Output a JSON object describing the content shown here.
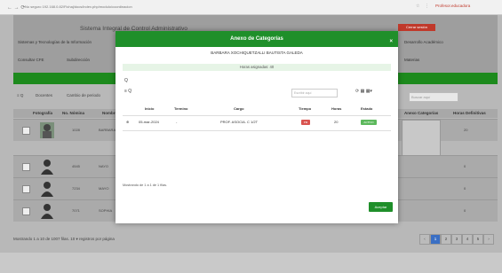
{
  "browser": {
    "nav": "←  →  ⟳",
    "url": "No seguro   192.168.0.82/Fichaj/docs/index.php/modulo/coordinacion",
    "ext1": "☆",
    "ext2": "⋮",
    "user": "Profesor.educadora"
  },
  "app": {
    "title": "Sistema Integral de Control Administrativo",
    "top_button": "Cerrar sesión",
    "menu1": "Sistemas y Tecnologías de la Información",
    "menu2": "Desarrollo Académico",
    "menu3": "Consultar CFE",
    "menu4": "Subdirección",
    "menu5": "Materias",
    "toolbar": {
      "nav": "≡  Q",
      "docentes": "Docentes",
      "cambio": "Cambio de periodo",
      "search_placeholder": "Buscar aquí"
    },
    "table_headers": {
      "fotografia": "Fotografía",
      "numero": "No. Nómina",
      "nombre": "Nombre",
      "anexo": "Anexo Categorías",
      "horas": "Horas Definitivas"
    },
    "rows": [
      {
        "id": "1028",
        "n": "BARBARA",
        "h": "20"
      },
      {
        "id": "4545",
        "n": "NAYO",
        "h": "0"
      },
      {
        "id": "7234",
        "n": "MAYO",
        "h": "0"
      },
      {
        "id": "7071",
        "n": "SOPHIA",
        "h": "0"
      }
    ],
    "footer": "Mostrando 1 a 10 de 1007 filas.   10 ▾  registros por página",
    "pages": [
      "‹",
      "1",
      "2",
      "3",
      "4",
      "5",
      "›"
    ]
  },
  "modal": {
    "title": "Anexo de Categorías",
    "close": "×",
    "name": "BARBARA XOCHIQUETZALLI BAUTISTA GALEDA",
    "hours": "Horas asignadas: 40",
    "search_icon": "Q",
    "tool_left": "≡  Q",
    "search_placeholder": "Escribir aquí",
    "tool_icons": "⟳   ▦   ▦▾",
    "headers": {
      "inicio": "Inicio",
      "termino": "Termino",
      "cargo": "Cargo",
      "tiempo": "Tiempo",
      "horas": "Horas",
      "estado": "Estado"
    },
    "row": {
      "expand": "⊕",
      "inicio": "05-mar-2024",
      "termino": "-",
      "cargo": "PROF. ASOCIA. C 1/2T",
      "tiempo": "PM",
      "horas": "20",
      "estado": "ACTIVO"
    },
    "info": "Mostrando de 1 a 1 de 1 filas.",
    "accept": "Aceptar"
  },
  "colors": {
    "modal_header": "#1f8f2a",
    "accept": "#1f8f2a",
    "danger": "#d9534f",
    "success": "#5cb85c"
  }
}
